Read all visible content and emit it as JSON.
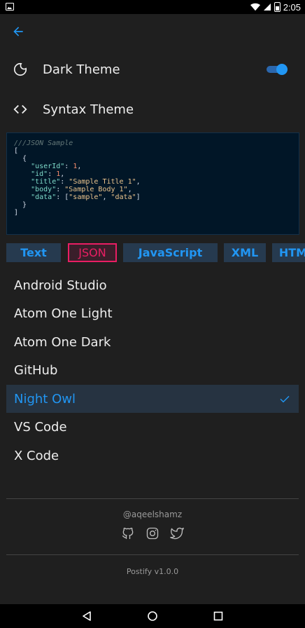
{
  "status_bar": {
    "time": "2:05",
    "battery_icon": "battery-icon",
    "wifi_icon": "wifi-icon",
    "signal_icon": "signal-icon"
  },
  "settings": {
    "dark_theme_label": "Dark Theme",
    "dark_theme_enabled": true,
    "syntax_theme_label": "Syntax Theme"
  },
  "code_sample": {
    "comment": "///JSON Sample",
    "line1": "[",
    "line2": "  {",
    "userId_key": "\"userId\"",
    "userId_val": "1",
    "id_key": "\"id\"",
    "id_val": "1",
    "title_key": "\"title\"",
    "title_val": "\"Sample Title 1\"",
    "body_key": "\"body\"",
    "body_val": "\"Sample Body 1\"",
    "data_key": "\"data\"",
    "data_val1": "\"sample\"",
    "data_val2": "\"data\"",
    "line_close_obj": "  }",
    "line_close_arr": "]"
  },
  "language_chips": [
    "Text",
    "JSON",
    "JavaScript",
    "XML",
    "HTM"
  ],
  "active_chip": "JSON",
  "themes": [
    "Android Studio",
    "Atom One Light",
    "Atom One Dark",
    "GitHub",
    "Night Owl",
    "VS Code",
    "X Code"
  ],
  "selected_theme": "Night Owl",
  "footer": {
    "handle": "@aqeelshamz",
    "version": "Postify v1.0.0"
  },
  "colors": {
    "accent": "#2196f3",
    "active_chip": "#e91e63",
    "background": "#1f1f1f"
  }
}
